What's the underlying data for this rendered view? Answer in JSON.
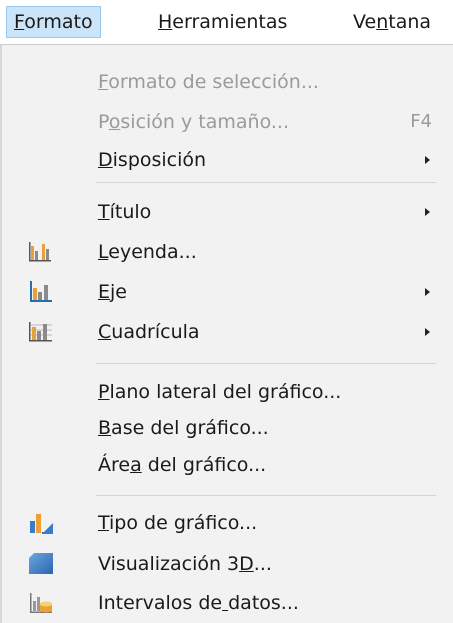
{
  "menubar": {
    "items": [
      {
        "label": "Formato",
        "mnemonic_index": 0
      },
      {
        "label": "Herramientas",
        "mnemonic_index": 0
      },
      {
        "label": "Ventana",
        "mnemonic_index": 2
      }
    ]
  },
  "menu": {
    "groups": [
      [
        {
          "label": "Formato de selección...",
          "mnemonic_index": 0,
          "disabled": true,
          "accel": ""
        },
        {
          "label": "Posición y tamaño...",
          "mnemonic_index": 1,
          "disabled": true,
          "accel": "F4"
        },
        {
          "label": "Disposición",
          "mnemonic_index": 0,
          "submenu": true
        }
      ],
      [
        {
          "label": "Título",
          "mnemonic_index": 0,
          "submenu": true
        },
        {
          "label": "Leyenda...",
          "mnemonic_index": 0,
          "icon": "legend-chart-icon"
        },
        {
          "label": "Eje",
          "mnemonic_index": 0,
          "submenu": true,
          "icon": "axis-chart-icon"
        },
        {
          "label": "Cuadrícula",
          "mnemonic_index": 0,
          "submenu": true,
          "icon": "grid-chart-icon"
        }
      ],
      [
        {
          "label": "Plano lateral del gráfico...",
          "mnemonic_index": 0
        },
        {
          "label": "Base del gráfico...",
          "mnemonic_index": 0
        },
        {
          "label": "Área del gráfico...",
          "mnemonic_index": 3
        }
      ],
      [
        {
          "label": "Tipo de gráfico...",
          "mnemonic_index": 0,
          "icon": "chart-type-icon"
        },
        {
          "label": "Visualización 3D...",
          "mnemonic_index": 15,
          "icon": "view-3d-icon"
        },
        {
          "label": "Intervalos de datos...",
          "mnemonic_index": 13,
          "icon": "data-ranges-icon"
        }
      ]
    ]
  },
  "colors": {
    "menubar_active_bg": "#cce4f7",
    "menu_bg": "#f2f2f2",
    "disabled_text": "#9a9a9a",
    "icon_blue": "#3a7bc8",
    "icon_orange": "#f0a030"
  }
}
